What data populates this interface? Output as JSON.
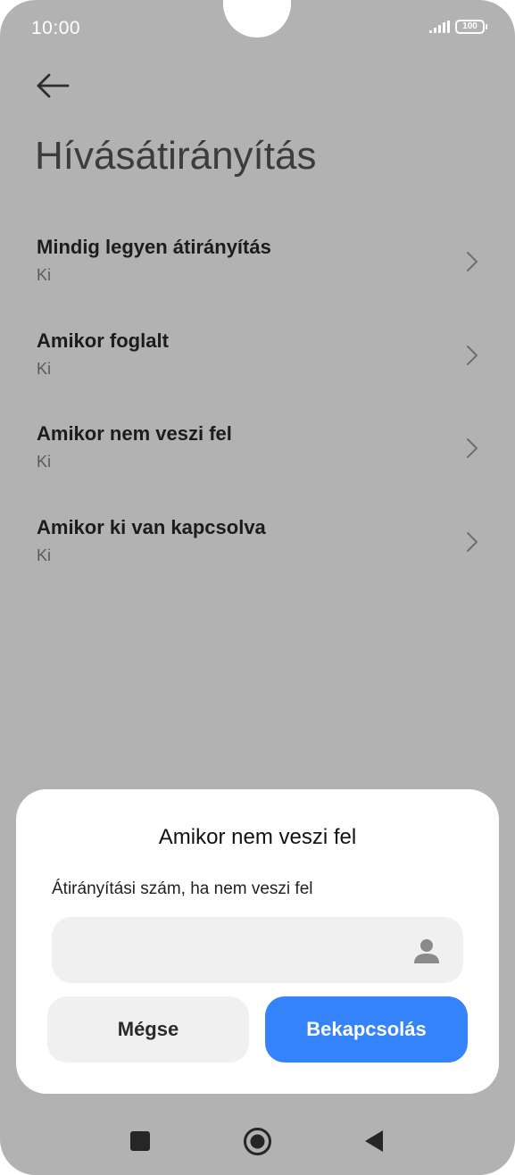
{
  "status_bar": {
    "time": "10:00",
    "battery": "100"
  },
  "header": {
    "back_icon": "arrow-left-icon",
    "title": "Hívásátirányítás"
  },
  "settings": {
    "items": [
      {
        "title": "Mindig legyen átirányítás",
        "status": "Ki"
      },
      {
        "title": "Amikor foglalt",
        "status": "Ki"
      },
      {
        "title": "Amikor nem veszi fel",
        "status": "Ki"
      },
      {
        "title": "Amikor ki van kapcsolva",
        "status": "Ki"
      }
    ]
  },
  "dialog": {
    "title": "Amikor nem veszi fel",
    "description": "Átirányítási szám, ha nem veszi fel",
    "input_value": "",
    "contact_icon": "person-icon",
    "cancel_label": "Mégse",
    "confirm_label": "Bekapcsolás"
  },
  "colors": {
    "background_dimmed": "#b2b2b2",
    "accent": "#3483fb",
    "dialog_bg": "#ffffff",
    "input_bg": "#f0f0f0"
  },
  "nav": {
    "recents_icon": "square-icon",
    "home_icon": "circle-icon",
    "back_icon": "triangle-back-icon"
  }
}
